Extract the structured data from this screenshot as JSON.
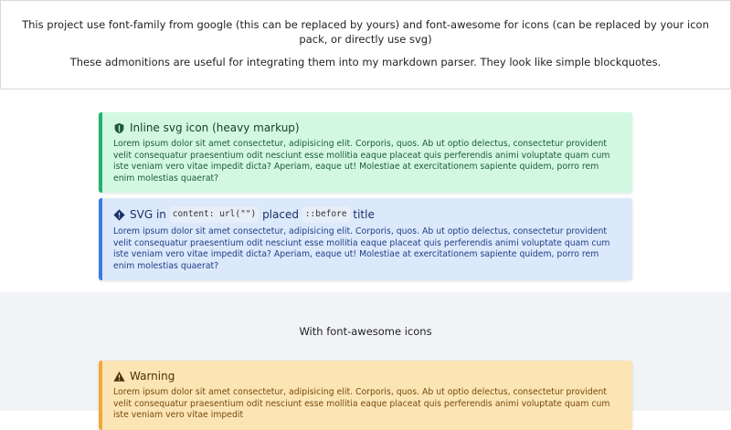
{
  "header": {
    "line1": "This project use font-family from google (this can be replaced by yours) and font-awesome for icons (can be replaced by your icon pack, or directly use svg)",
    "line2": "These admonitions are useful for integrating them into my markdown parser. They look like simple blockquotes."
  },
  "admonitions": {
    "green": {
      "title": "Inline svg icon (heavy markup)",
      "icon": "shield-icon",
      "color": "#21b36b",
      "body": "Lorem ipsum dolor sit amet consectetur, adipisicing elit. Corporis, quos. Ab ut optio delectus, consectetur provident velit consequatur praesentium odit nesciunt esse mollitia eaque placeat quis perferendis animi voluptate quam cum iste veniam vero vitae impedit dicta? Aperiam, eaque ut! Molestiae at exercitationem sapiente quidem, porro rem enim molestias quaerat?"
    },
    "blue": {
      "title_pre": "SVG in",
      "title_code1": "content: url(\"\")",
      "title_mid": "placed",
      "title_code2": "::before",
      "title_post": "title",
      "icon": "diamond-info-icon",
      "color": "#3b7be6",
      "body": "Lorem ipsum dolor sit amet consectetur, adipisicing elit. Corporis, quos. Ab ut optio delectus, consectetur provident velit consequatur praesentium odit nesciunt esse mollitia eaque placeat quis perferendis animi voluptate quam cum iste veniam vero vitae impedit dicta? Aperiam, eaque ut! Molestiae at exercitationem sapiente quidem, porro rem enim molestias quaerat?"
    },
    "orange": {
      "title": "Warning",
      "icon": "warning-triangle-icon",
      "color": "#f0a93b",
      "body": "Lorem ipsum dolor sit amet consectetur, adipisicing elit. Corporis, quos. Ab ut optio delectus, consectetur provident velit consequatur praesentium odit nesciunt esse mollitia eaque placeat quis perferendis animi voluptate quam cum iste veniam vero vitae impedit"
    }
  },
  "section2": {
    "title": "With font-awesome icons"
  }
}
